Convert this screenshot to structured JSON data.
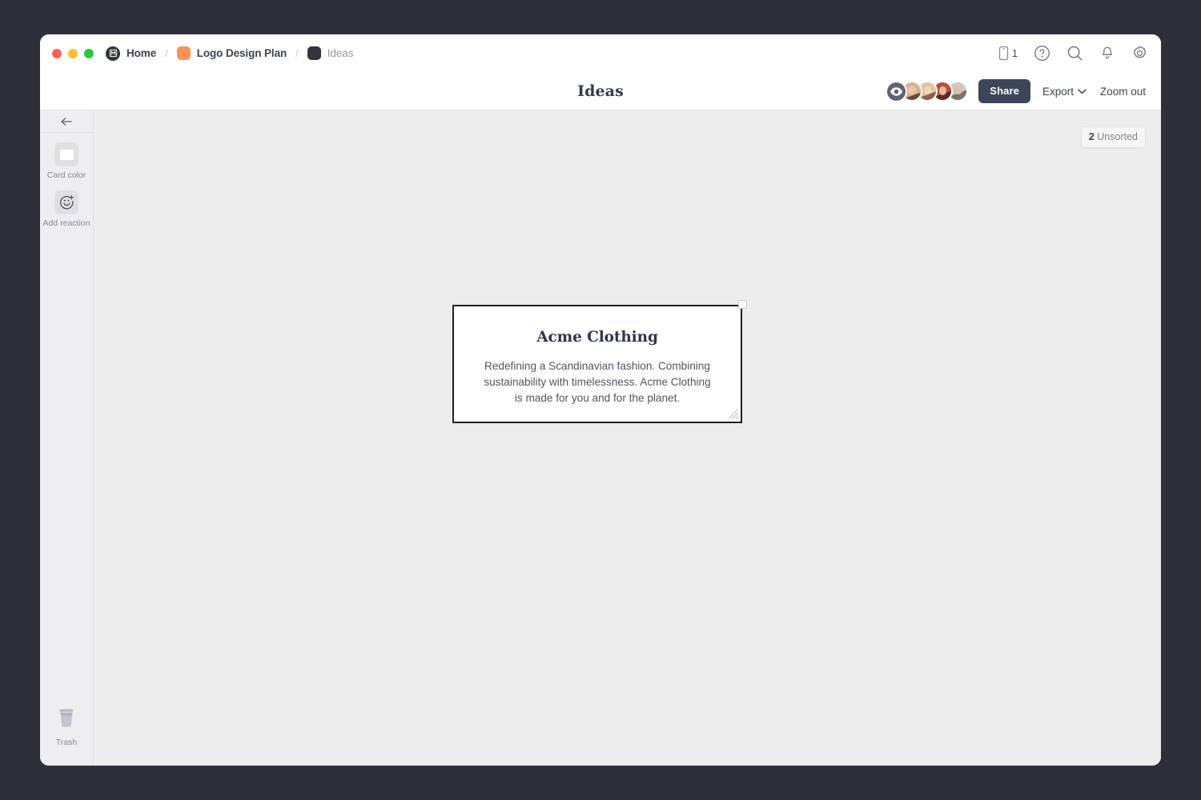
{
  "window": {
    "traffic_lights": [
      "close",
      "minimize",
      "zoom"
    ]
  },
  "breadcrumb": [
    {
      "label": "Home",
      "icon": "milanote-logo-icon",
      "current": false
    },
    {
      "label": "Logo Design Plan",
      "icon": "orange-square-icon",
      "current": false
    },
    {
      "label": "Ideas",
      "icon": "dark-square-icon",
      "current": true
    }
  ],
  "breadcrumb_separator": "/",
  "titlebar_icons": {
    "mobile_label": "1",
    "items": [
      "mobile-icon",
      "help-icon",
      "search-icon",
      "bell-icon",
      "gear-icon"
    ]
  },
  "header": {
    "title": "Ideas",
    "share_label": "Share",
    "export_label": "Export",
    "zoom_label": "Zoom out",
    "viewer_count_icon": "eye-icon",
    "avatars": 4
  },
  "sidebar": {
    "back_icon": "arrow-left-icon",
    "tools": [
      {
        "label": "Card color",
        "icon": "color-swatch-icon"
      },
      {
        "label": "Add reaction",
        "icon": "smiley-plus-icon"
      }
    ],
    "trash": {
      "label": "Trash",
      "icon": "trash-icon"
    }
  },
  "canvas": {
    "unsorted_count": "2",
    "unsorted_label": "Unsorted",
    "note": {
      "title": "Acme Clothing",
      "body": "Redefining a Scandinavian fashion. Combining sustainability with timelessness. Acme Clothing is made for you and for the planet.",
      "selected": true
    }
  },
  "colors": {
    "backdrop": "#2f2f39",
    "canvas": "#ededee",
    "sidebar": "#eeeef0",
    "accent_orange": "#f89455",
    "share_button": "#3d4558",
    "text_dark": "#3d4355",
    "text_muted": "#84889a"
  }
}
